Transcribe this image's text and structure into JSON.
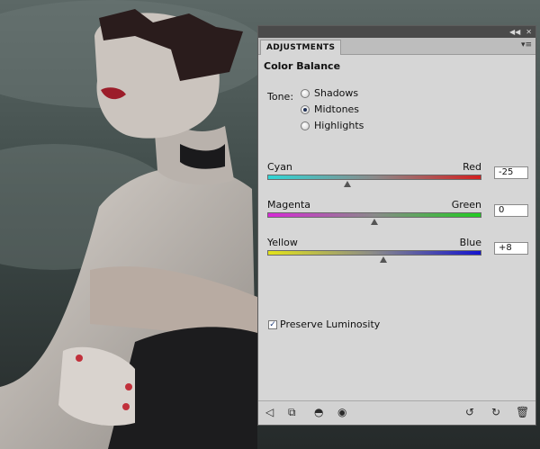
{
  "panel": {
    "tab_label": "ADJUSTMENTS",
    "title": "Color Balance",
    "tone_label": "Tone:",
    "tones": [
      {
        "label": "Shadows",
        "selected": false
      },
      {
        "label": "Midtones",
        "selected": true
      },
      {
        "label": "Highlights",
        "selected": false
      }
    ],
    "sliders": [
      {
        "left": "Cyan",
        "right": "Red",
        "value": "-25",
        "left_color": "#2fd6d6",
        "right_color": "#d42020",
        "position": -25
      },
      {
        "left": "Magenta",
        "right": "Green",
        "value": "0",
        "left_color": "#d62ad6",
        "right_color": "#21cc21",
        "position": 0
      },
      {
        "left": "Yellow",
        "right": "Blue",
        "value": "+8",
        "left_color": "#e3e31a",
        "right_color": "#1414d0",
        "position": 8
      }
    ],
    "preserve_luminosity": {
      "label": "Preserve Luminosity",
      "checked": true
    }
  },
  "icons": {
    "collapse": "collapse-double-arrow-icon",
    "close": "close-icon",
    "panel_menu": "panel-menu-icon",
    "back": "back-arrow-icon",
    "clip": "clip-to-layer-icon",
    "visibility_toggle": "adjustment-visibility-icon",
    "eye": "eye-icon",
    "view_previous": "view-previous-state-icon",
    "reset": "reset-icon",
    "trash": "trash-icon"
  }
}
